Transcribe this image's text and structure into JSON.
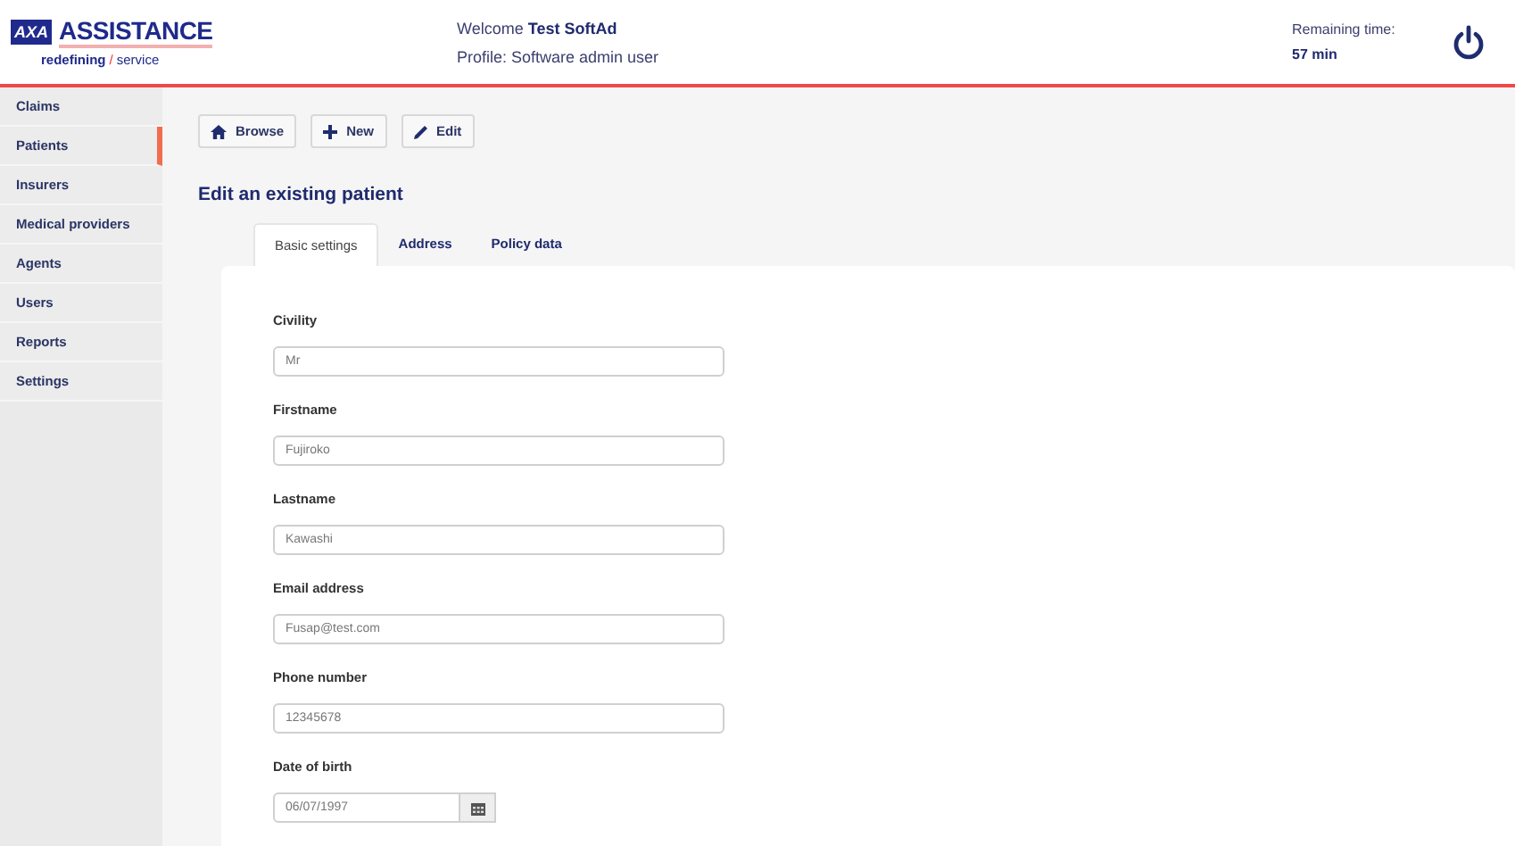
{
  "logo": {
    "mark": "AXA",
    "name": "ASSISTANCE",
    "tagline_1": "redefining",
    "slash": "/",
    "tagline_2": "service"
  },
  "welcome": {
    "greeting": "Welcome",
    "user": "Test SoftAd",
    "profile": "Profile: Software admin user"
  },
  "session": {
    "label": "Remaining time:",
    "value": "57 min"
  },
  "sidebar": {
    "items": [
      {
        "label": "Claims",
        "selected": false
      },
      {
        "label": "Patients",
        "selected": true
      },
      {
        "label": "Insurers",
        "selected": false
      },
      {
        "label": "Medical providers",
        "selected": false
      },
      {
        "label": "Agents",
        "selected": false
      },
      {
        "label": "Users",
        "selected": false
      },
      {
        "label": "Reports",
        "selected": false
      },
      {
        "label": "Settings",
        "selected": false
      }
    ]
  },
  "toolbar": [
    {
      "kind": "home",
      "label": "Browse"
    },
    {
      "kind": "plus",
      "label": "New"
    },
    {
      "kind": "pencil",
      "label": "Edit"
    }
  ],
  "title": "Edit an existing patient",
  "tabs": [
    {
      "label": "Basic settings",
      "selected": true
    },
    {
      "label": "Address",
      "selected": false
    },
    {
      "label": "Policy data",
      "selected": false
    }
  ],
  "fields": [
    {
      "kind": "text",
      "label": "Civility",
      "value": "Mr"
    },
    {
      "kind": "text",
      "label": "Firstname",
      "value": "Fujiroko"
    },
    {
      "kind": "text",
      "label": "Lastname",
      "value": "Kawashi"
    },
    {
      "kind": "text",
      "label": "Email address",
      "value": "Fusap@test.com"
    },
    {
      "kind": "text",
      "label": "Phone number",
      "value": "12345678"
    },
    {
      "kind": "date",
      "label": "Date of birth",
      "value": "06/07/1997"
    }
  ]
}
